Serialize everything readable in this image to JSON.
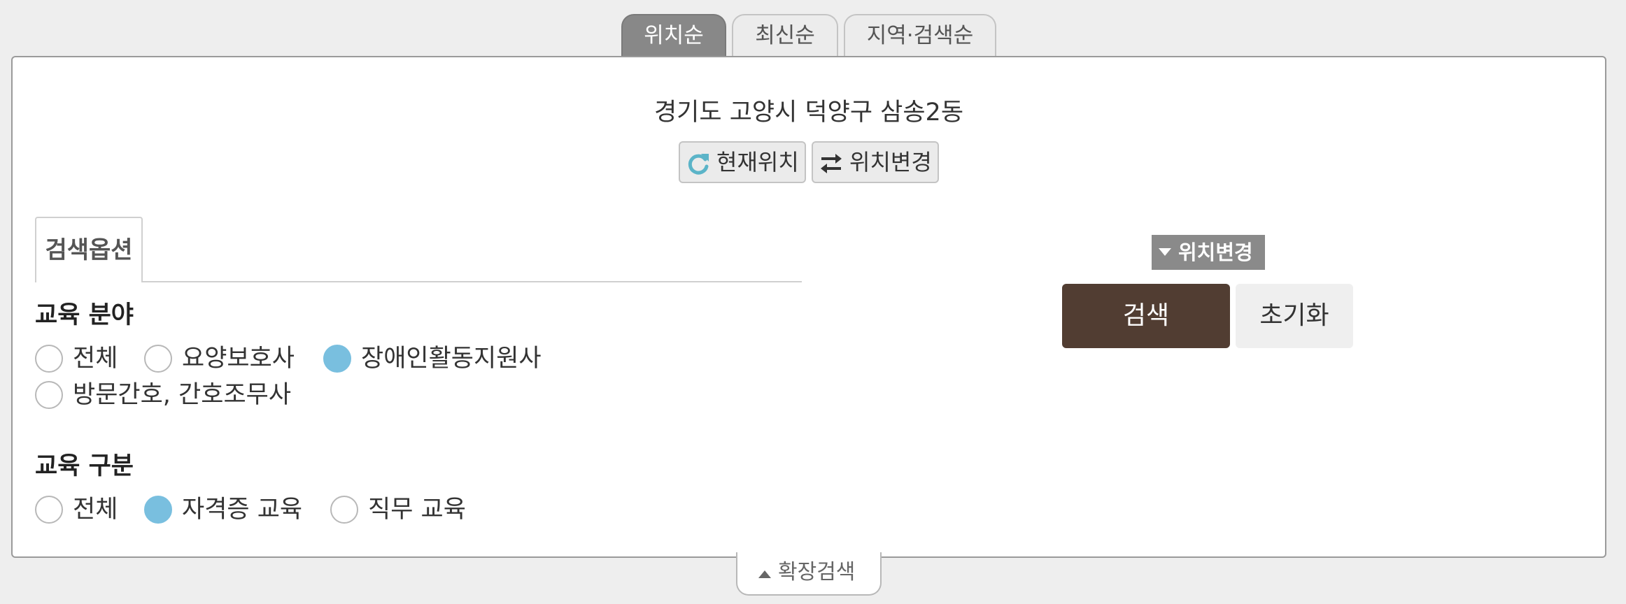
{
  "tabs": [
    {
      "label": "위치순",
      "active": true
    },
    {
      "label": "최신순",
      "active": false
    },
    {
      "label": "지역·검색순",
      "active": false
    }
  ],
  "location": {
    "address": "경기도 고양시 덕양구 삼송2동",
    "current_btn": "현재위치",
    "change_btn": "위치변경"
  },
  "options": {
    "tab_label": "검색옵션",
    "field": {
      "title": "교육 분야",
      "items": [
        {
          "label": "전체",
          "checked": false
        },
        {
          "label": "요양보호사",
          "checked": false
        },
        {
          "label": "장애인활동지원사",
          "checked": true
        },
        {
          "label": "방문간호, 간호조무사",
          "checked": false
        }
      ]
    },
    "type": {
      "title": "교육 구분",
      "items": [
        {
          "label": "전체",
          "checked": false
        },
        {
          "label": "자격증 교육",
          "checked": true
        },
        {
          "label": "직무 교육",
          "checked": false
        }
      ]
    }
  },
  "actions": {
    "location_toggle": "위치변경",
    "search": "검색",
    "reset": "초기화"
  },
  "expand": {
    "label": "확장검색"
  },
  "colors": {
    "active_tab": "#888888",
    "search_button": "#513d32",
    "radio_checked": "#79bfdf",
    "refresh_icon": "#5bb4c8"
  },
  "icons": {
    "current": "refresh-icon",
    "change": "swap-arrows-icon",
    "toggle": "caret-down-icon",
    "expand": "caret-up-icon"
  }
}
